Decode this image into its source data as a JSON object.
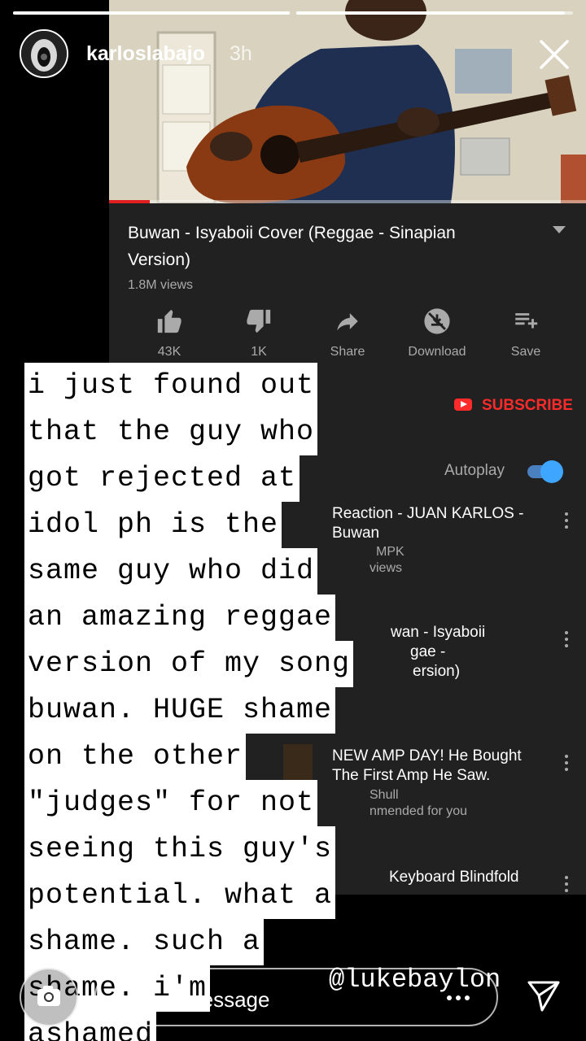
{
  "story": {
    "progress_segments": [
      1,
      0.97
    ],
    "username": "karloslabajo",
    "time": "3h"
  },
  "youtube": {
    "title": "Buwan - Isyaboii Cover (Reggae - Sinapian Version)",
    "views": "1.8M views",
    "actions": [
      {
        "label": "43K",
        "icon": "thumbs-up-icon"
      },
      {
        "label": "1K",
        "icon": "thumbs-down-icon"
      },
      {
        "label": "Share",
        "icon": "share-icon"
      },
      {
        "label": "Download",
        "icon": "download-icon"
      },
      {
        "label": "Save",
        "icon": "save-playlist-icon"
      }
    ],
    "subscribe": "SUBSCRIBE",
    "autoplay": "Autoplay",
    "recommendations": [
      {
        "title_line1": "Reaction - JUAN KARLOS -",
        "title_line2": "Buwan",
        "sub1": "MPK",
        "sub2": "views"
      },
      {
        "title_line1": "wan - Isyaboii",
        "title_line2": "gae -",
        "title_line3": "ersion)"
      },
      {
        "title_line1": "NEW AMP DAY! He Bought",
        "title_line2": "The First Amp He Saw.",
        "sub1": "Shull",
        "sub2": "nmended for you"
      },
      {
        "title_line1": "Keyboard Blindfold"
      }
    ]
  },
  "overlay_text": [
    "i just found out",
    "that the guy who",
    "got rejected at",
    "idol ph is the",
    "same guy who did",
    "an amazing reggae",
    "version of my song",
    "buwan. HUGE shame",
    "on the other",
    "\"judges\" for not",
    "seeing this guy's",
    "potential. what a",
    "shame. such a",
    "shame. i'm",
    "ashamed"
  ],
  "mention": "@lukebaylon",
  "reply": {
    "placeholder": "Send message"
  },
  "colors": {
    "yt_bg": "#212121",
    "accent_red": "#ff2b2b",
    "toggle_blue": "#3ea6ff"
  }
}
